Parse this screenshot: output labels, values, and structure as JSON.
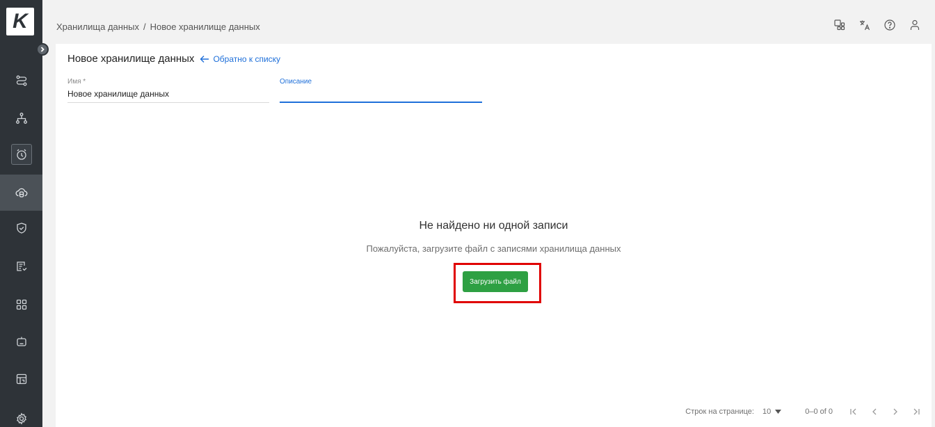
{
  "app": {
    "logo_letter": "K"
  },
  "header": {
    "breadcrumb": [
      "Хранилища данных",
      "/",
      "Новое хранилище данных"
    ],
    "icons": [
      "apps-icon",
      "translate-icon",
      "help-icon",
      "user-icon"
    ]
  },
  "sidebar": {
    "items": [
      {
        "icon": "route-icon"
      },
      {
        "icon": "hierarchy-icon"
      },
      {
        "icon": "alarm-clock-icon"
      },
      {
        "icon": "database-cloud-icon",
        "active": true
      },
      {
        "icon": "shield-check-icon"
      },
      {
        "icon": "document-list-icon"
      },
      {
        "icon": "grid-icon"
      },
      {
        "icon": "robot-icon"
      },
      {
        "icon": "calendar-icon"
      },
      {
        "icon": "settings-icon"
      }
    ]
  },
  "page": {
    "title": "Новое хранилище данных",
    "back_link": "Обратно к списку",
    "fields": {
      "name_label": "Имя *",
      "name_value": "Новое хранилище данных",
      "description_label": "Описание",
      "description_value": ""
    },
    "empty_state": {
      "title": "Не найдено ни одной записи",
      "subtitle": "Пожалуйста, загрузите файл с записями хранилища данных",
      "upload_button": "Загрузить файл"
    },
    "pagination": {
      "rows_label": "Строк на странице:",
      "rows_value": "10",
      "range": "0–0 of 0"
    }
  },
  "colors": {
    "accent": "#1e6fd9",
    "success": "#2ea043",
    "highlight": "#e00000",
    "sidebar": "#2e3338"
  }
}
